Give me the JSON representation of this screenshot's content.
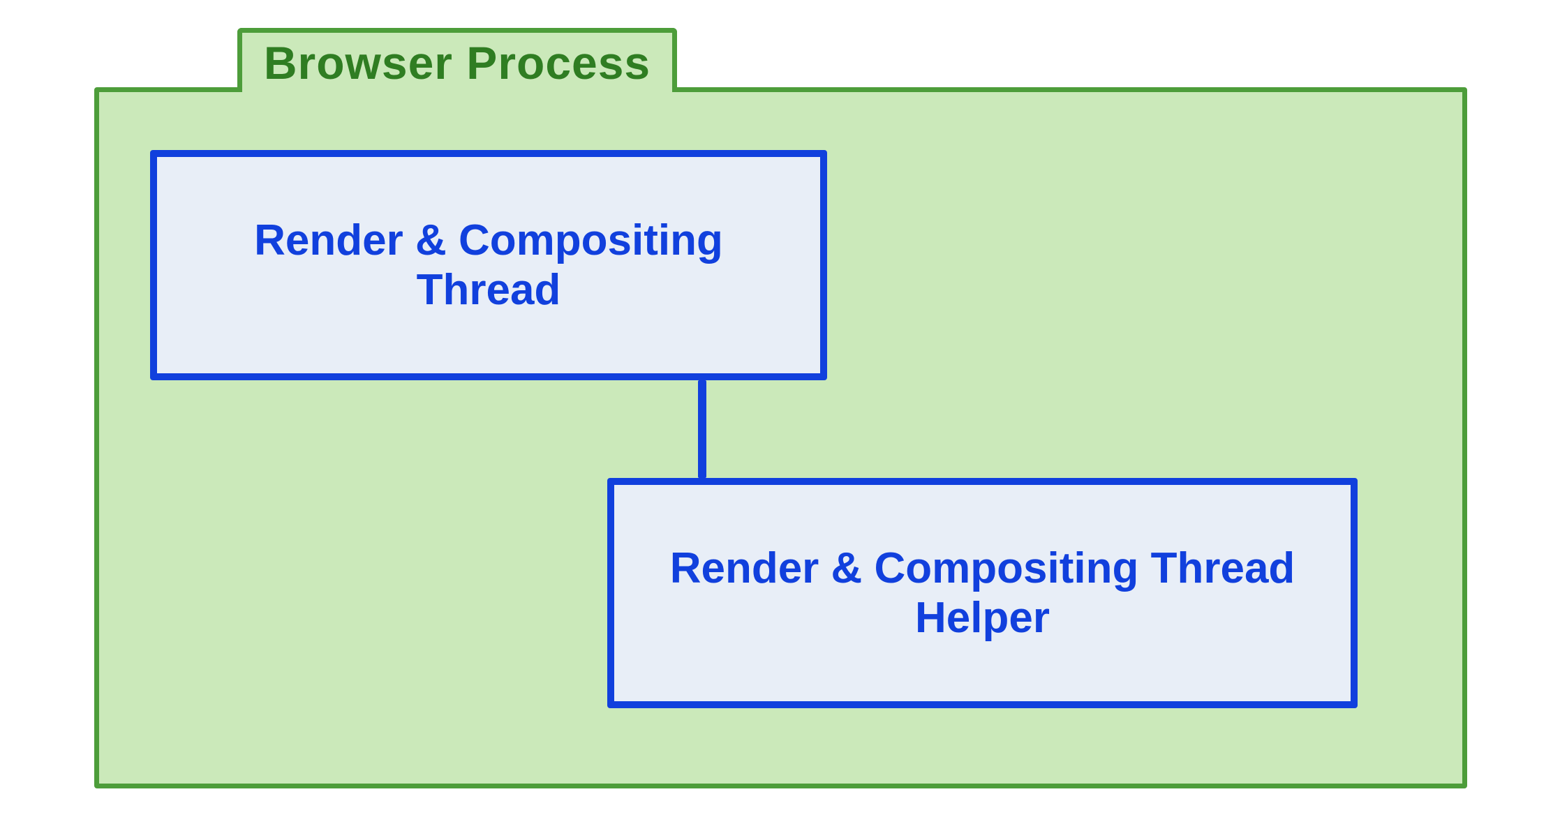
{
  "diagram": {
    "container_label": "Browser Process",
    "nodes": {
      "render_compositing_thread": "Render & Compositing Thread",
      "render_compositing_thread_helper": "Render & Compositing Thread Helper"
    },
    "colors": {
      "container_fill": "#cbe9ba",
      "container_border": "#4d9d3a",
      "container_text": "#2f7d22",
      "node_fill": "#e8eef7",
      "node_border": "#1140dd",
      "node_text": "#1140dd"
    }
  }
}
